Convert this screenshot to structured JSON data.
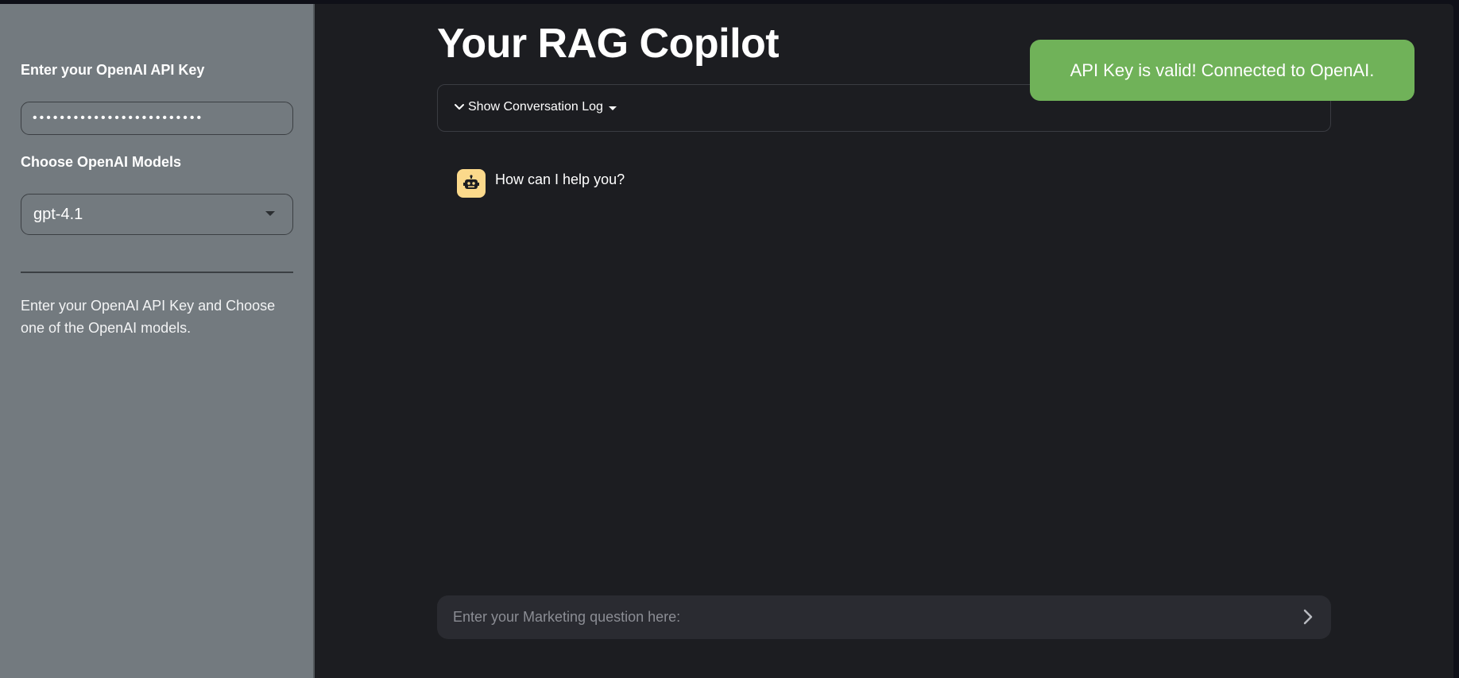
{
  "sidebar": {
    "api_key_label": "Enter your OpenAI API Key",
    "api_key_value": "•••••••••••••••••••••••••",
    "model_label": "Choose OpenAI Models",
    "model_selected": "gpt-4.1",
    "help_text": "Enter your OpenAI API Key and Choose one of the OpenAI models."
  },
  "main": {
    "title": "Your RAG Copilot",
    "conversation_log_toggle": "Show Conversation Log",
    "messages": [
      {
        "role": "assistant",
        "avatar_icon": "robot-icon",
        "text": "How can I help you?"
      }
    ],
    "chat_input_placeholder": "Enter your Marketing question here:"
  },
  "toast": {
    "text": "API Key is valid! Connected to OpenAI."
  },
  "colors": {
    "sidebar_bg": "#737a7f",
    "main_bg": "#1c1d21",
    "toast_bg": "#70b259",
    "avatar_bg": "#fbd98b",
    "chat_input_bg": "#2a2b31"
  }
}
